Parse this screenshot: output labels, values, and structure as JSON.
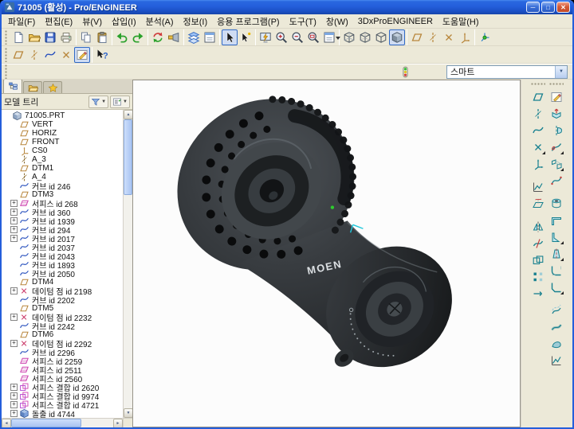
{
  "window": {
    "title": "71005 (활성) - Pro/ENGINEER",
    "minimize_label": "─",
    "maximize_label": "□",
    "close_label": "✕"
  },
  "glyphs": {
    "combo_arrow": "▼",
    "expander": "+",
    "scroll_up": "▲",
    "scroll_down": "▼",
    "scroll_left": "◄",
    "scroll_right": "►"
  },
  "menubar": {
    "items": [
      {
        "id": "file",
        "label": "파일(F)"
      },
      {
        "id": "edit",
        "label": "편집(E)"
      },
      {
        "id": "view",
        "label": "뷰(V)"
      },
      {
        "id": "insert",
        "label": "삽입(I)"
      },
      {
        "id": "analysis",
        "label": "분석(A)"
      },
      {
        "id": "info",
        "label": "정보(I)"
      },
      {
        "id": "applications",
        "label": "응용 프로그램(P)"
      },
      {
        "id": "tools",
        "label": "도구(T)"
      },
      {
        "id": "window",
        "label": "창(W)"
      },
      {
        "id": "3dxproengineer",
        "label": "3DxProENGINEER"
      },
      {
        "id": "help",
        "label": "도움말(H)"
      }
    ]
  },
  "toolbars": {
    "row1": [
      "grip",
      {
        "id": "new-file-button",
        "icon": "file-new"
      },
      {
        "id": "open-file-button",
        "icon": "folder-open"
      },
      {
        "id": "save-button",
        "icon": "floppy"
      },
      {
        "id": "print-button",
        "icon": "printer"
      },
      "sep",
      {
        "id": "copy-button",
        "icon": "copy"
      },
      {
        "id": "paste-button",
        "icon": "paste"
      },
      "sep",
      {
        "id": "undo-button",
        "icon": "undo"
      },
      {
        "id": "redo-button",
        "icon": "redo"
      },
      "sep",
      {
        "id": "regenerate-button",
        "icon": "regen"
      },
      {
        "id": "search-button",
        "icon": "flashlight"
      },
      "sep",
      {
        "id": "layers-button",
        "icon": "layers"
      },
      {
        "id": "view-manager-button",
        "icon": "viewmgr"
      },
      "sep",
      {
        "id": "select-arrow-button",
        "icon": "arrow-cursor",
        "pressed": true
      },
      {
        "id": "smart-select-button",
        "icon": "arrow-smart"
      },
      "sep",
      {
        "id": "repaint-button",
        "icon": "repaint"
      },
      {
        "id": "zoom-in-button",
        "icon": "zoom-in"
      },
      {
        "id": "zoom-out-button",
        "icon": "zoom-out"
      },
      {
        "id": "refit-button",
        "icon": "refit"
      },
      {
        "id": "saved-views-button",
        "icon": "viewmgr",
        "dropdown": true
      },
      "sep",
      {
        "id": "wireframe-button",
        "icon": "wireframe"
      },
      {
        "id": "hidden-line-button",
        "icon": "hiddenline"
      },
      {
        "id": "no-hidden-button",
        "icon": "nohidden"
      },
      {
        "id": "shaded-button",
        "icon": "shaded",
        "pressed": true
      },
      "sep",
      {
        "id": "datum-planes-toggle",
        "icon": "dp-toggle"
      },
      {
        "id": "datum-axes-toggle",
        "icon": "da-toggle"
      },
      {
        "id": "datum-points-toggle",
        "icon": "dpt-toggle"
      },
      {
        "id": "csys-toggle",
        "icon": "dcs-toggle"
      },
      "sep",
      {
        "id": "spin-center-toggle",
        "icon": "spincenter"
      }
    ],
    "row2": [
      "grip",
      {
        "id": "datum-plane-tool-button",
        "icon": "dp-toggle"
      },
      {
        "id": "datum-axis-tool-button",
        "icon": "da-toggle"
      },
      {
        "id": "datum-curve-tool-button",
        "icon": "curve-blue"
      },
      {
        "id": "datum-point-tool-button",
        "icon": "dpt-toggle"
      },
      {
        "id": "sketch-tool-button",
        "icon": "sketchpencil",
        "pressed": true
      },
      "sep",
      {
        "id": "context-help-button",
        "icon": "helpk"
      }
    ],
    "selection_filter": {
      "status_icon": "traffic",
      "label": "스마트"
    }
  },
  "navigator": {
    "tabs": [
      {
        "id": "model-tree-tab",
        "icon": "tab-tree",
        "active": true
      },
      {
        "id": "folder-browser-tab",
        "icon": "folder-open",
        "active": false
      },
      {
        "id": "favorites-tab",
        "icon": "tab-star",
        "active": false
      }
    ],
    "panel_title": "모델 트리",
    "header_buttons": [
      {
        "id": "tree-show-menu-button",
        "icon": "hdr-show"
      },
      {
        "id": "tree-settings-menu-button",
        "icon": "hdr-settings"
      }
    ],
    "tree": [
      {
        "label": "71005.PRT",
        "icon": "part",
        "indent": 0,
        "expand": false
      },
      {
        "label": "VERT",
        "icon": "datum-plane",
        "indent": 1,
        "expand": false
      },
      {
        "label": "HORIZ",
        "icon": "datum-plane",
        "indent": 1,
        "expand": false
      },
      {
        "label": "FRONT",
        "icon": "datum-plane",
        "indent": 1,
        "expand": false
      },
      {
        "label": "CS0",
        "icon": "csys",
        "indent": 1,
        "expand": false
      },
      {
        "label": "A_3",
        "icon": "axis",
        "indent": 1,
        "expand": false
      },
      {
        "label": "DTM1",
        "icon": "datum-plane",
        "indent": 1,
        "expand": false
      },
      {
        "label": "A_4",
        "icon": "axis",
        "indent": 1,
        "expand": false
      },
      {
        "label": "커브 id 246",
        "icon": "curve",
        "indent": 1,
        "expand": false
      },
      {
        "label": "DTM3",
        "icon": "datum-plane",
        "indent": 1,
        "expand": false
      },
      {
        "label": "서피스 id 268",
        "icon": "surface",
        "indent": 1,
        "expand": true
      },
      {
        "label": "커브 id 360",
        "icon": "curve",
        "indent": 1,
        "expand": true
      },
      {
        "label": "커브 id 1939",
        "icon": "curve",
        "indent": 1,
        "expand": true
      },
      {
        "label": "커브 id 294",
        "icon": "curve",
        "indent": 1,
        "expand": true
      },
      {
        "label": "커브 id 2017",
        "icon": "curve",
        "indent": 1,
        "expand": true
      },
      {
        "label": "커브 id 2037",
        "icon": "curve",
        "indent": 1,
        "expand": false
      },
      {
        "label": "커브 id 2043",
        "icon": "curve",
        "indent": 1,
        "expand": false
      },
      {
        "label": "커브 id 1893",
        "icon": "curve",
        "indent": 1,
        "expand": false
      },
      {
        "label": "커브 id 2050",
        "icon": "curve",
        "indent": 1,
        "expand": false
      },
      {
        "label": "DTM4",
        "icon": "datum-plane",
        "indent": 1,
        "expand": false
      },
      {
        "label": "데이텀 점 id 2198",
        "icon": "datum-point",
        "indent": 1,
        "expand": true
      },
      {
        "label": "커브 id 2202",
        "icon": "curve",
        "indent": 1,
        "expand": false
      },
      {
        "label": "DTM5",
        "icon": "datum-plane",
        "indent": 1,
        "expand": false
      },
      {
        "label": "데이텀 점 id 2232",
        "icon": "datum-point",
        "indent": 1,
        "expand": true
      },
      {
        "label": "커브 id 2242",
        "icon": "curve",
        "indent": 1,
        "expand": false
      },
      {
        "label": "DTM6",
        "icon": "datum-plane",
        "indent": 1,
        "expand": false
      },
      {
        "label": "데이텀 점 id 2292",
        "icon": "datum-point",
        "indent": 1,
        "expand": true
      },
      {
        "label": "커브 id 2296",
        "icon": "curve",
        "indent": 1,
        "expand": false
      },
      {
        "label": "서피스 id 2259",
        "icon": "surface",
        "indent": 1,
        "expand": false
      },
      {
        "label": "서피스 id 2511",
        "icon": "surface",
        "indent": 1,
        "expand": false
      },
      {
        "label": "서피스 id 2560",
        "icon": "surface",
        "indent": 1,
        "expand": false
      },
      {
        "label": "서피스 결합 id 2620",
        "icon": "quilt",
        "indent": 1,
        "expand": true
      },
      {
        "label": "서피스 결합 id 9974",
        "icon": "quilt",
        "indent": 1,
        "expand": true
      },
      {
        "label": "서피스 결합 id 4721",
        "icon": "quilt",
        "indent": 1,
        "expand": true
      },
      {
        "label": "돌출 id 4744",
        "icon": "extrude",
        "indent": 1,
        "expand": true
      }
    ]
  },
  "viewport": {
    "brand_label": "MOEN"
  },
  "right_toolbar": {
    "col1": [
      {
        "id": "datum-plane-tool",
        "icon": "r-plane"
      },
      {
        "id": "datum-axis-tool",
        "icon": "r-axis"
      },
      {
        "id": "datum-curve-tool",
        "icon": "r-curve"
      },
      {
        "id": "datum-point-tool",
        "icon": "r-point",
        "flyout": true
      },
      {
        "id": "csys-tool",
        "icon": "r-csys"
      },
      "gap",
      {
        "id": "analysis-tool",
        "icon": "r-analysis"
      },
      {
        "id": "project-tool",
        "icon": "r-project"
      },
      "gap",
      {
        "id": "mirror-tool",
        "icon": "r-mirror"
      },
      {
        "id": "trim-tool",
        "icon": "r-trim"
      },
      {
        "id": "merge-tool",
        "icon": "r-merge"
      },
      {
        "id": "pattern-tool",
        "icon": "r-pattern"
      },
      {
        "id": "extend-tool",
        "icon": "r-extend"
      }
    ],
    "col2": [
      {
        "id": "sketch-tool",
        "icon": "sketchpencil"
      },
      {
        "id": "extrude-tool",
        "icon": "r-extrude"
      },
      {
        "id": "revolve-tool",
        "icon": "r-revolve"
      },
      {
        "id": "sweep-tool",
        "icon": "r-sweep",
        "flyout": true
      },
      {
        "id": "blend-tool",
        "icon": "r-blend",
        "flyout": true
      },
      {
        "id": "style-tool",
        "icon": "r-style"
      },
      "gap",
      {
        "id": "hole-tool",
        "icon": "r-hole"
      },
      {
        "id": "shell-tool",
        "icon": "r-shell"
      },
      {
        "id": "rib-tool",
        "icon": "r-rib",
        "flyout": true
      },
      {
        "id": "draft-tool",
        "icon": "r-draft",
        "flyout": true
      },
      {
        "id": "round-tool",
        "icon": "r-round"
      },
      {
        "id": "chamfer-tool",
        "icon": "r-chamfer",
        "flyout": true
      },
      "gap",
      {
        "id": "offset-tool",
        "icon": "r-offset"
      },
      {
        "id": "thicken-tool",
        "icon": "r-thicken"
      },
      {
        "id": "solidify-tool",
        "icon": "r-solidify"
      },
      {
        "id": "section-tool",
        "icon": "r-analysis"
      }
    ]
  },
  "colors": {
    "titlebar": "#245edb",
    "toolbar_bg": "#ece9d8",
    "pressed_border": "#316ac5",
    "datum_tan": "#b8863b",
    "curve_blue": "#2a52be",
    "surface_pink": "#cc3fae",
    "feature_teal": "#17808f"
  }
}
